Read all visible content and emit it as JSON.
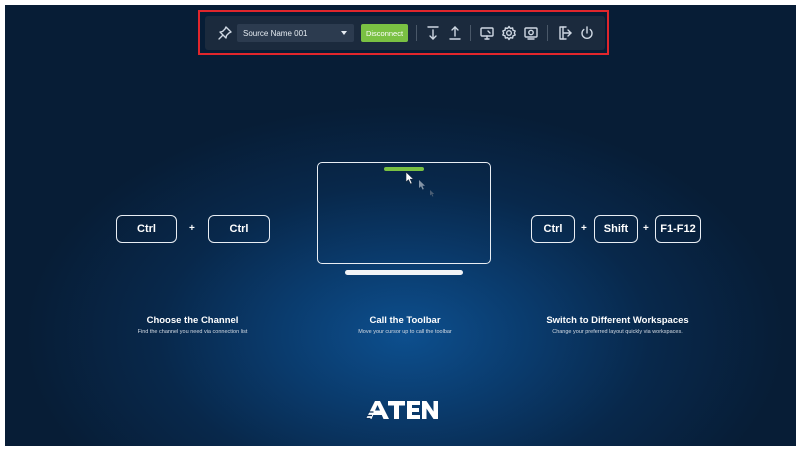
{
  "toolbar": {
    "source_name": "Source Name 001",
    "disconnect_label": "Disconnect",
    "icons": [
      "pin-icon",
      "snap-down-icon",
      "snap-up-icon",
      "display-icon",
      "settings-icon",
      "screenshot-icon",
      "exit-icon",
      "power-icon"
    ]
  },
  "shortcuts": {
    "channel": {
      "keys": [
        "Ctrl",
        "Ctrl"
      ],
      "plus": "+"
    },
    "workspaces": {
      "keys": [
        "Ctrl",
        "Shift",
        "F1-F12"
      ],
      "plus": "+"
    }
  },
  "captions": [
    {
      "title": "Choose the Channel",
      "description": "Find the channel you need via connection list"
    },
    {
      "title": "Call the Toolbar",
      "description": "Move your cursor up to call the toolbar"
    },
    {
      "title": "Switch to Different Workspaces",
      "description": "Change your preferred layout quickly via workspaces."
    }
  ],
  "brand": {
    "logo_text": "ATEN",
    "accent_color": "#7ac143",
    "highlight_color": "#e0262c"
  }
}
